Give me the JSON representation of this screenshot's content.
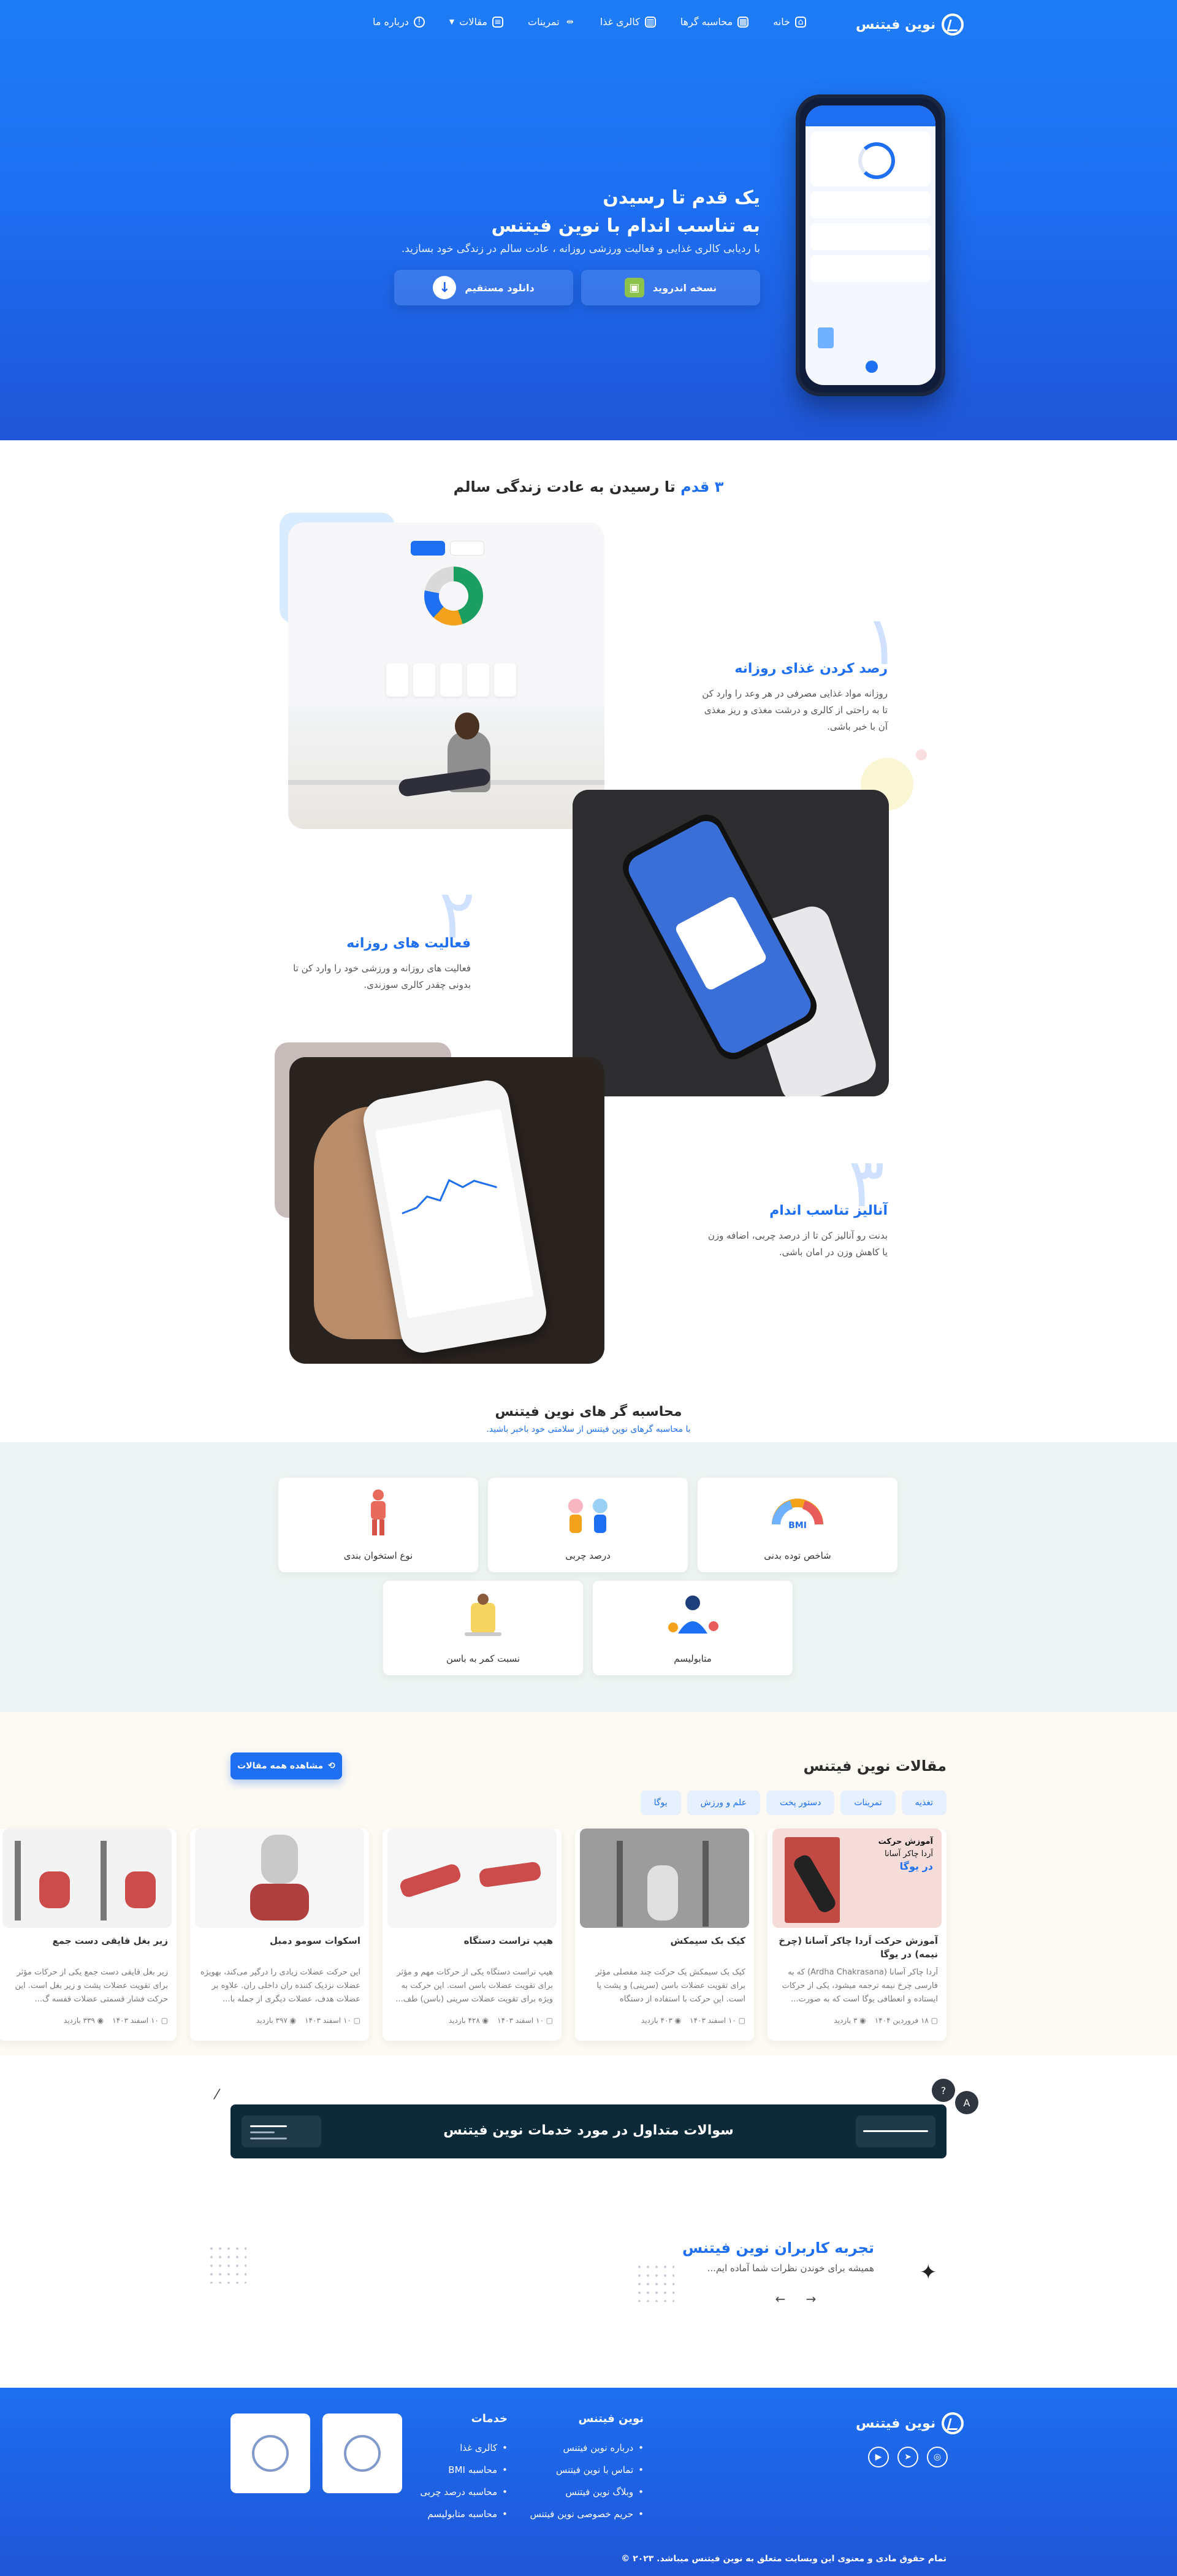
{
  "brand": {
    "name": "نوین فیتنس"
  },
  "nav": {
    "items": [
      {
        "label": "خانه",
        "icon": "home-icon"
      },
      {
        "label": "محاسبه گرها",
        "icon": "calculator-icon"
      },
      {
        "label": "کالری غذا",
        "icon": "food-icon"
      },
      {
        "label": "تمرینات",
        "icon": "dumbbell-icon"
      },
      {
        "label": "مقالات",
        "icon": "articles-icon"
      },
      {
        "label": "درباره ما",
        "icon": "info-icon"
      }
    ]
  },
  "hero": {
    "title_line1": "یک قدم تا رسیدن",
    "title_line2": "به تناسب اندام با نوین فیتنس",
    "subtitle": "با ردیابی کالری غذایی و فعالیت ورزشی روزانه ، عادت سالم در زندگی خود بسازید.",
    "android_button": "نسخه اندروید",
    "direct_button": "دانلود مستقیم"
  },
  "steps": {
    "title_number": "۳ قدم",
    "title_rest": "تا رسیدن به عادت زندگی سالم",
    "items": [
      {
        "number": "۱",
        "title": "رصد کردن غذای روزانه",
        "text_line1": "روزانه مواد غذایی مصرفی در هر وعد را وارد کن",
        "text_line2": "تا به راحتی از کالری و درشت مغذی و ریز مغذی",
        "text_line3": "آن با خبر باشی."
      },
      {
        "number": "۲",
        "title": "فعالیت های روزانه",
        "text_line1": "فعالیت های روزانه و ورزشی خود را وارد کن تا",
        "text_line2": "بدونی چقدر کالری سوزندی."
      },
      {
        "number": "۳",
        "title": "آنالیز تناسب اندام",
        "text_line1": "بدنت رو آنالیز کن تا از درصد چربی، اضافه وزن",
        "text_line2": "یا کاهش وزن در امان باشی."
      }
    ]
  },
  "calculators": {
    "title": "محاسبه گر های نوین فیتنس",
    "subtitle": "با محاسبه گرهای نوین فیتنس از سلامتی خود باخبر باشید.",
    "cards": [
      {
        "label": "شاخص توده بدنی",
        "badge": "BMI"
      },
      {
        "label": "درصد چربی"
      },
      {
        "label": "نوع استخوان بندی"
      },
      {
        "label": "متابولیسم"
      },
      {
        "label": "نسبت کمر به باسن"
      }
    ]
  },
  "articles": {
    "title": "مقالات نوین فیتنس",
    "view_all": "مشاهده همه مقالات",
    "categories": [
      "تغذیه",
      "تمرینات",
      "دستور پخت",
      "علم و ورزش",
      "یوگا"
    ],
    "cards": [
      {
        "title": "آموزش حرکت اَردا چاکر آسانا (چرخ نیمه) در یوگا",
        "body": "اَردا چاکر آسانا (Ardha Chakrasana) که به فارسی چرخ نیمه ترجمه میشود، یکی از حرکات ایستاده و انعطافی یوگا است که به صورت...",
        "date": "۱۸ فروردین ۱۴۰۴",
        "views": "۳ بازدید",
        "image_caption_1": "آموزش حرکت",
        "image_caption_2": "اَردا چاکر آسانا",
        "image_caption_3": "در یوگا"
      },
      {
        "title": "کیک بک سیمکش",
        "body": "کیک بک سیمکش یک حرکت چند مفصلی مؤثر برای تقویت عضلات باسن (سرینی) و پشت پا است. این حرکت با استفاده از دستگاه سیمکش...",
        "date": "۱۰ اسفند ۱۴۰۳",
        "views": "۴۰۳ بازدید"
      },
      {
        "title": "هیپ تراست دستگاه",
        "body": "هیپ تراست دستگاه یکی از حرکات مهم و مؤثر برای تقویت عضلات باسن است. این حرکت به ویژه برای تقویت عضلات سرینی (باسن) طف...",
        "date": "۱۰ اسفند ۱۴۰۳",
        "views": "۴۲۸ بازدید"
      },
      {
        "title": "اسکوات سومو دمبل",
        "body": "این حرکت عضلات زیادی را درگیر می‌کند، بهویژه عضلات نزدیک کننده ران داخلی ران. علاوه بر عضلات هدف، عضلات دیگری از جمله با...",
        "date": "۱۰ اسفند ۱۴۰۳",
        "views": "۳۹۷ بازدید"
      },
      {
        "title": "زیر بغل قایقی دست جمع",
        "body": "زیر بغل قایقی دست جمع یکی از حرکات مؤثر برای تقویت عضلات پشت و زیر بغل است. این حرکت فشار قسمتی عضلات قفسه گ...",
        "date": "۱۰ اسفند ۱۴۰۳",
        "views": "۳۳۹ بازدید"
      }
    ]
  },
  "faq": {
    "title": "سوالات متداول در مورد خدمات نوین فیتنس"
  },
  "testimonials": {
    "title": "تجربه کاربران نوین فیتنس",
    "subtitle": "همیشه برای خوندن نظرات شما آماده ایم..."
  },
  "footer": {
    "col1_title": "نوین فیتنس",
    "col1_items": [
      "درباره نوین فیتنس",
      "تماس با نوین فیتنس",
      "وبلاگ نوین فیتنس",
      "حریم خصوصی نوین فیتنس"
    ],
    "col2_title": "خدمات",
    "col2_items": [
      "کالری غذا",
      "محاسبه BMI",
      "محاسبه درصد چربی",
      "محاسبه متابولیسم"
    ],
    "copyright": "تمام حقوق مادی و معنوی این وبسایت متعلق به نوین فیتنس میباشد. ۲۰۲۳ ©"
  },
  "colors": {
    "primary": "#1e6ff1",
    "dark": "#0d2a38",
    "calc_band": "#eef4f3",
    "article_band": "#fdfaf3"
  }
}
